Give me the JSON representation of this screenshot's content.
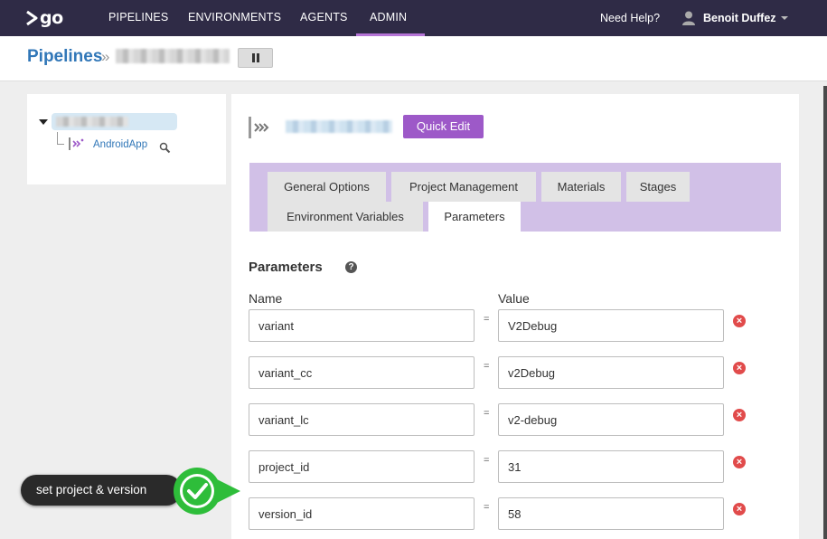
{
  "nav": {
    "logo_text": "go",
    "items": [
      {
        "label": "PIPELINES"
      },
      {
        "label": "ENVIRONMENTS"
      },
      {
        "label": "AGENTS"
      },
      {
        "label": "ADMIN"
      }
    ],
    "help": "Need Help?",
    "user": "Benoit Duffez",
    "active_color": "#b574d6"
  },
  "breadcrumb": {
    "root": "Pipelines",
    "separator": "»"
  },
  "tree": {
    "pipeline": "AndroidApp"
  },
  "main": {
    "quick_edit": "Quick Edit",
    "tabs": [
      {
        "label": "General Options"
      },
      {
        "label": "Project Management"
      },
      {
        "label": "Materials"
      },
      {
        "label": "Stages"
      },
      {
        "label": "Environment Variables"
      },
      {
        "label": "Parameters",
        "active": true
      }
    ],
    "section_title": "Parameters",
    "help_glyph": "?",
    "columns": {
      "name": "Name",
      "value": "Value"
    },
    "equals": "=",
    "parameters": [
      {
        "name": "variant",
        "value": "V2Debug"
      },
      {
        "name": "variant_cc",
        "value": "v2Debug"
      },
      {
        "name": "variant_lc",
        "value": "v2-debug"
      },
      {
        "name": "project_id",
        "value": "31"
      },
      {
        "name": "version_id",
        "value": "58"
      }
    ]
  },
  "annotation": {
    "text": "set project & version",
    "color": "#2ebd3a"
  },
  "colors": {
    "nav_bg": "#2f2b46",
    "link": "#3177b8",
    "button": "#9d59c8",
    "tab_bg": "#d1c0e7",
    "delete": "#e14b4b"
  }
}
